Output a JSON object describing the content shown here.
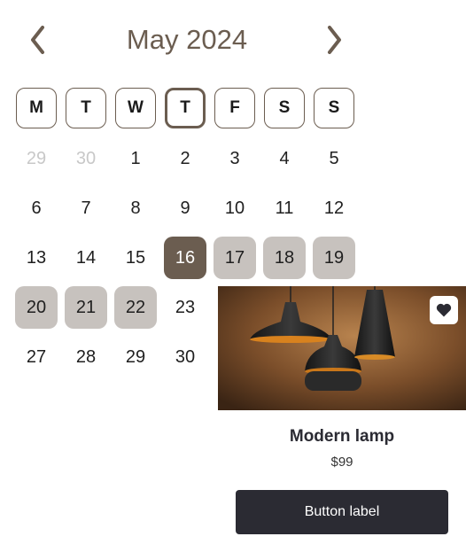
{
  "calendar": {
    "month_title": "May 2024",
    "accent_color": "#6b5d50",
    "range_color": "#c7c2be",
    "weekdays": [
      "M",
      "T",
      "W",
      "T",
      "F",
      "S",
      "S"
    ],
    "today_weekday_index": 3,
    "weeks": [
      [
        {
          "d": "29",
          "muted": true
        },
        {
          "d": "30",
          "muted": true
        },
        {
          "d": "1"
        },
        {
          "d": "2"
        },
        {
          "d": "3"
        },
        {
          "d": "4"
        },
        {
          "d": "5"
        }
      ],
      [
        {
          "d": "6"
        },
        {
          "d": "7"
        },
        {
          "d": "8"
        },
        {
          "d": "9"
        },
        {
          "d": "10"
        },
        {
          "d": "11"
        },
        {
          "d": "12"
        }
      ],
      [
        {
          "d": "13"
        },
        {
          "d": "14"
        },
        {
          "d": "15"
        },
        {
          "d": "16",
          "selected": true
        },
        {
          "d": "17",
          "range": true
        },
        {
          "d": "18",
          "range": true
        },
        {
          "d": "19",
          "range": true
        }
      ],
      [
        {
          "d": "20",
          "range": true
        },
        {
          "d": "21",
          "range": true
        },
        {
          "d": "22",
          "range": true
        },
        {
          "d": "23"
        }
      ],
      [
        {
          "d": "27"
        },
        {
          "d": "28"
        },
        {
          "d": "29"
        },
        {
          "d": "30"
        }
      ]
    ],
    "icons": {
      "prev": "chevron-left-icon",
      "next": "chevron-right-icon"
    }
  },
  "product_card": {
    "title": "Modern lamp",
    "price": "$99",
    "button_label": "Button label",
    "favorite_icon": "heart-icon"
  }
}
